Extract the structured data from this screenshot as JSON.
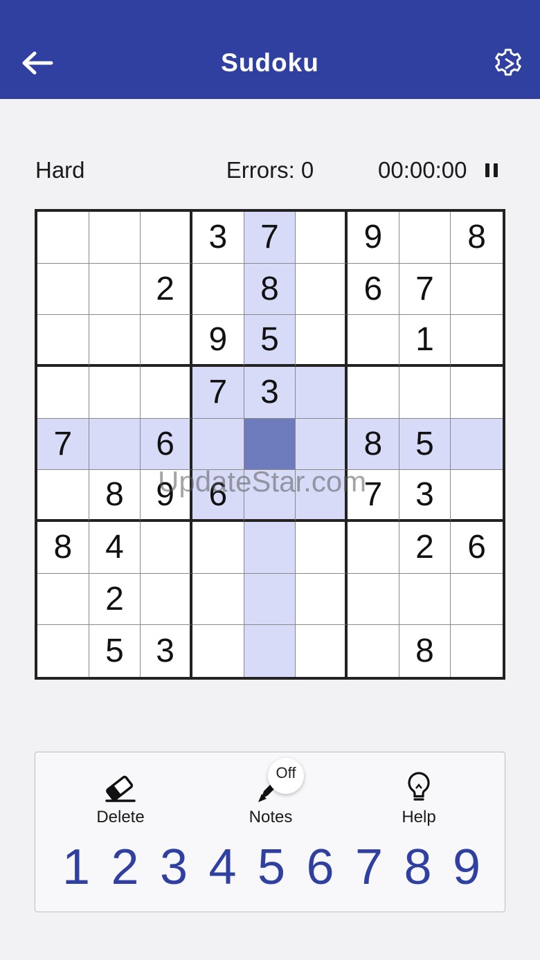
{
  "app": {
    "title": "Sudoku"
  },
  "icons": {
    "back": "arrow-left-icon",
    "settings": "gear-icon",
    "pause": "pause-icon",
    "delete": "eraser-icon",
    "notes": "pencil-icon",
    "help": "lightbulb-icon"
  },
  "colors": {
    "brand": "#2f40a0",
    "highlight": "#d8dbf8",
    "selected": "#6e7bbd"
  },
  "status": {
    "difficulty": "Hard",
    "errors": "Errors: 0",
    "timer": "00:00:00"
  },
  "watermark": "UpdateStar.com",
  "board": {
    "rows": [
      [
        "",
        "",
        "",
        "3",
        "7",
        "",
        "9",
        "",
        "8"
      ],
      [
        "",
        "",
        "2",
        "",
        "8",
        "",
        "6",
        "7",
        ""
      ],
      [
        "",
        "",
        "",
        "9",
        "5",
        "",
        "",
        "1",
        ""
      ],
      [
        "",
        "",
        "",
        "7",
        "3",
        "",
        "",
        "",
        ""
      ],
      [
        "7",
        "",
        "6",
        "",
        "",
        "",
        "8",
        "5",
        ""
      ],
      [
        "",
        "8",
        "9",
        "6",
        "",
        "",
        "7",
        "3",
        ""
      ],
      [
        "8",
        "4",
        "",
        "",
        "",
        "",
        "",
        "2",
        "6"
      ],
      [
        "",
        "2",
        "",
        "",
        "",
        "",
        "",
        "",
        ""
      ],
      [
        "",
        "5",
        "3",
        "",
        "",
        "",
        "",
        "8",
        ""
      ]
    ],
    "selected": {
      "row": 4,
      "col": 4
    }
  },
  "controls": {
    "delete_label": "Delete",
    "notes_label": "Notes",
    "notes_state": "Off",
    "help_label": "Help",
    "numbers": [
      "1",
      "2",
      "3",
      "4",
      "5",
      "6",
      "7",
      "8",
      "9"
    ]
  }
}
